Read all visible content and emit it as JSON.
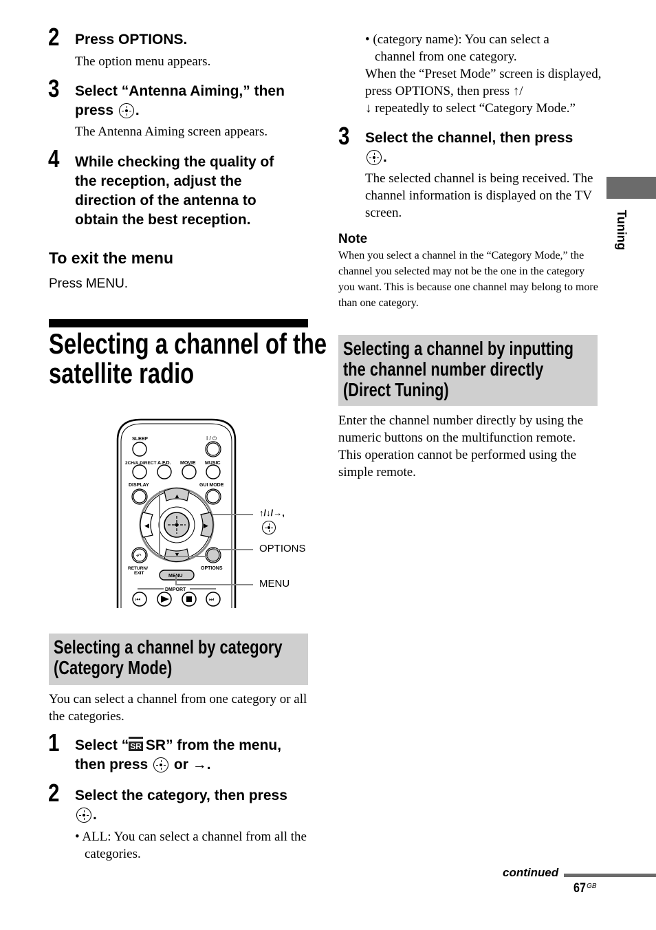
{
  "left_column": {
    "steps_top": [
      {
        "number": "2",
        "title": "Press OPTIONS.",
        "body": "The option menu appears."
      },
      {
        "number": "3",
        "title_part1": "Select “Antenna Aiming,” then",
        "title_part2": "press",
        "title_end": ".",
        "body": "The Antenna Aiming screen appears."
      },
      {
        "number": "4",
        "title_lines": [
          "While checking the quality of",
          "the reception, adjust the",
          "direction of the antenna to",
          "obtain the best reception."
        ]
      }
    ],
    "exit_menu": {
      "heading": "To exit the menu",
      "body": "Press MENU."
    },
    "section_title_lines": [
      "Selecting a channel of the",
      "satellite radio"
    ],
    "remote": {
      "button_labels": {
        "sleep": "SLEEP",
        "power": "I / ⏻",
        "two_ch": "2CH/A.DIRECT",
        "afd": "A.F.D.",
        "movie": "MOVIE",
        "music": "MUSIC",
        "display": "DISPLAY",
        "gui_mode": "GUI MODE",
        "return_exit_1": "RETURN/",
        "return_exit_2": "EXIT",
        "options": "OPTIONS",
        "menu": "MENU",
        "dmport": "DMPORT"
      },
      "callouts": {
        "arrows": "↑/↓/→,",
        "options": "OPTIONS",
        "menu": "MENU"
      }
    },
    "category_mode": {
      "heading_lines": [
        "Selecting a channel by category",
        "(Category Mode)"
      ],
      "intro": "You can select a channel from one category or all the categories.",
      "step1": {
        "number": "1",
        "part1": "Select “",
        "icon_text": "SR",
        "part2": "SR” from the menu,",
        "part3": "then press",
        "part4": "or →."
      },
      "step2": {
        "number": "2",
        "title": "Select the category, then press",
        "title_end": ".",
        "bullet": "• ALL: You can select a channel from all the categories."
      }
    }
  },
  "right_column": {
    "bullet_category": "• (category name): You can select a channel from one category.",
    "preset_text_1": "When the “Preset Mode” screen is displayed, press OPTIONS, then press ↑/",
    "preset_text_2": "↓ repeatedly to select “Category Mode.”",
    "step3": {
      "number": "3",
      "title": "Select the channel, then press",
      "title_end": ".",
      "body": "The selected channel is being received. The channel information is displayed on the TV screen."
    },
    "note": {
      "heading": "Note",
      "body": "When you select a channel in the “Category Mode,” the channel you selected may not be the one in the category you want. This is because one channel may belong to more than one category."
    },
    "direct_tuning": {
      "heading_lines": [
        "Selecting a channel by inputting",
        "the channel number directly",
        "(Direct Tuning)"
      ],
      "body": "Enter the channel number directly by using the numeric buttons on the multifunction remote. This operation cannot be performed using the simple remote."
    }
  },
  "side_tab": {
    "label": "Tuning"
  },
  "footer": {
    "continued": "continued",
    "page_number": "67",
    "page_suffix": "GB"
  }
}
